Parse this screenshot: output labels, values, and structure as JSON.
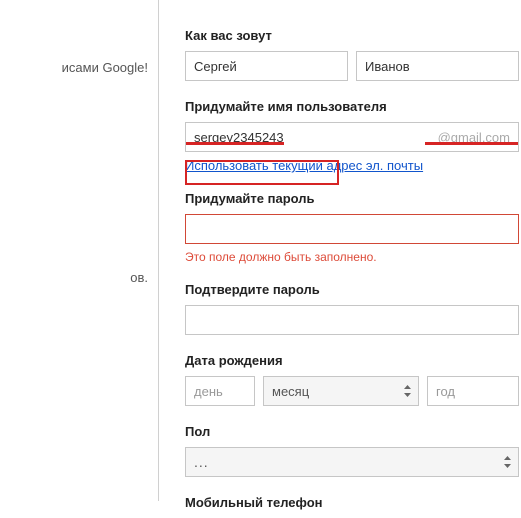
{
  "left": {
    "text1": "исами Google!",
    "text2": "ов."
  },
  "name": {
    "label": "Как вас зовут",
    "first": "Сергей",
    "last": "Иванов"
  },
  "username": {
    "label": "Придумайте имя пользователя",
    "value": "sergey2345243",
    "suffix": "@gmail.com",
    "link": "Использовать текущий адрес эл. почты"
  },
  "password": {
    "label": "Придумайте пароль",
    "value": "",
    "error": "Это поле должно быть заполнено."
  },
  "confirm": {
    "label": "Подтвердите пароль",
    "value": ""
  },
  "dob": {
    "label": "Дата рождения",
    "day_placeholder": "день",
    "month": "месяц",
    "year_placeholder": "год"
  },
  "gender": {
    "label": "Пол",
    "value": "..."
  },
  "phone": {
    "label": "Мобильный телефон"
  }
}
